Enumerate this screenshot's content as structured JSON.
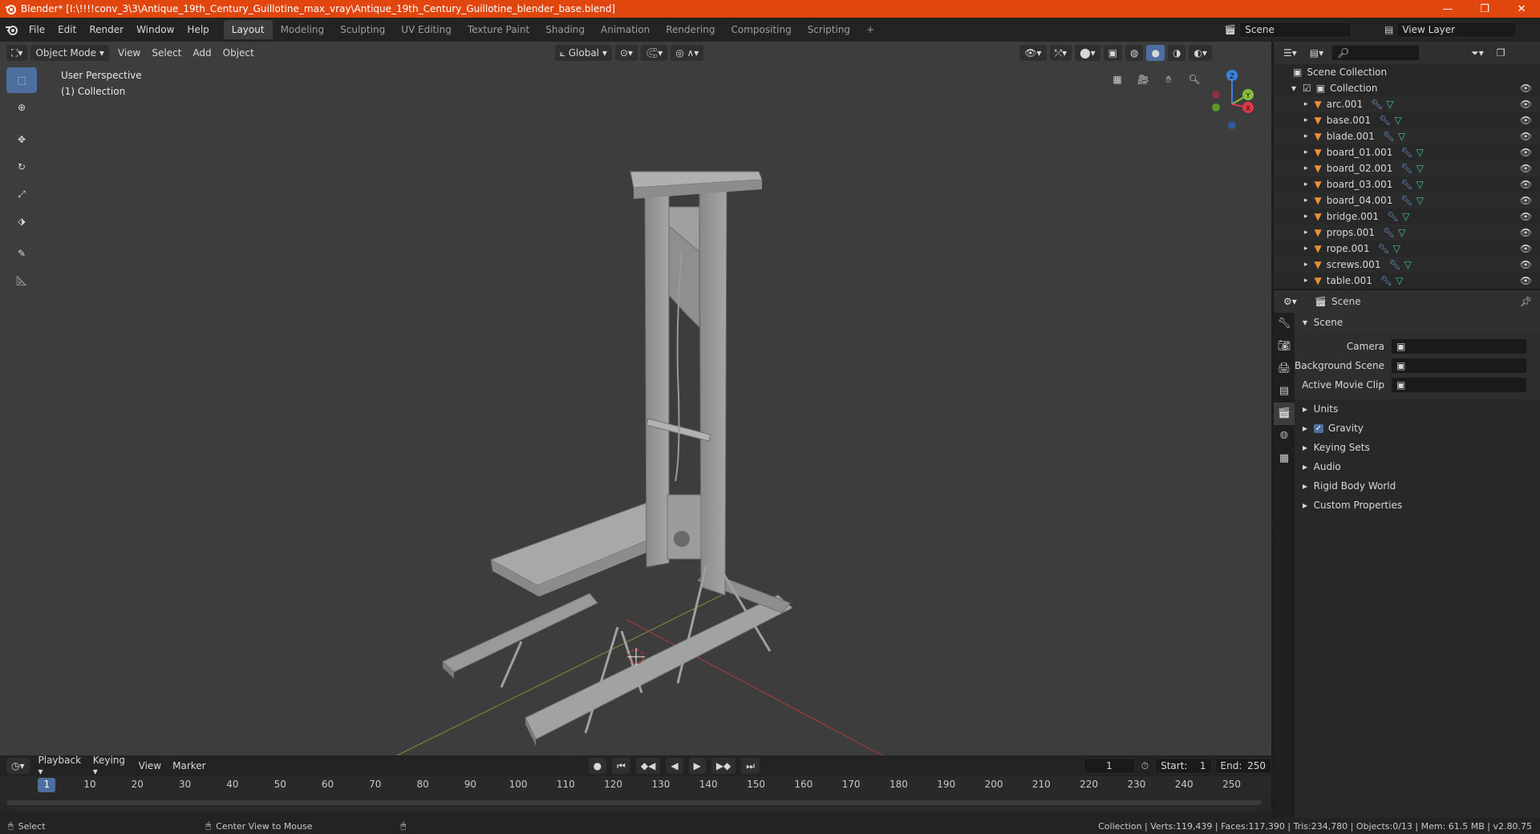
{
  "window": {
    "title": "Blender* [I:\\!!!!conv_3\\3\\Antique_19th_Century_Guillotine_max_vray\\Antique_19th_Century_Guillotine_blender_base.blend]",
    "minimize": "—",
    "maximize": "❐",
    "close": "✕"
  },
  "menu": [
    "File",
    "Edit",
    "Render",
    "Window",
    "Help"
  ],
  "workspaces": [
    "Layout",
    "Modeling",
    "Sculpting",
    "UV Editing",
    "Texture Paint",
    "Shading",
    "Animation",
    "Rendering",
    "Compositing",
    "Scripting"
  ],
  "active_workspace": "Layout",
  "scene_name": "Scene",
  "view_layer": "View Layer",
  "viewport_header": {
    "mode": "Object Mode",
    "menus": [
      "View",
      "Select",
      "Add",
      "Object"
    ],
    "transform_orientation": "Global"
  },
  "viewport": {
    "perspective": "User Perspective",
    "collection": "(1) Collection",
    "gizmo": {
      "z": "Z",
      "y": "Y",
      "x": "X"
    }
  },
  "outliner": {
    "root": "Scene Collection",
    "collection": "Collection",
    "objects": [
      "arc.001",
      "base.001",
      "blade.001",
      "board_01.001",
      "board_02.001",
      "board_03.001",
      "board_04.001",
      "bridge.001",
      "props.001",
      "rope.001",
      "screws.001",
      "table.001"
    ]
  },
  "properties": {
    "context": "Scene",
    "panel_title": "Scene",
    "fields": [
      {
        "label": "Camera",
        "value": ""
      },
      {
        "label": "Background Scene",
        "value": ""
      },
      {
        "label": "Active Movie Clip",
        "value": ""
      }
    ],
    "sections": [
      "Units",
      "Gravity",
      "Keying Sets",
      "Audio",
      "Rigid Body World",
      "Custom Properties"
    ],
    "gravity_checked": true
  },
  "timeline": {
    "menus": [
      "Playback",
      "Keying",
      "View",
      "Marker"
    ],
    "current_frame": "1",
    "start_label": "Start:",
    "start": "1",
    "end_label": "End:",
    "end": "250",
    "ticks": [
      "1",
      "10",
      "20",
      "30",
      "40",
      "50",
      "60",
      "70",
      "80",
      "90",
      "100",
      "110",
      "120",
      "130",
      "140",
      "150",
      "160",
      "170",
      "180",
      "190",
      "200",
      "210",
      "220",
      "230",
      "240",
      "250"
    ]
  },
  "status": {
    "left": "Select",
    "middle": "Center View to Mouse",
    "right": "Collection | Verts:119,439 | Faces:117,390 | Tris:234,780 | Objects:0/13 | Mem: 61.5 MB | v2.80.75"
  },
  "colors": {
    "titlebar": "#e0460e",
    "accent": "#4d6fa0",
    "object_icon": "#e6913a",
    "mesh_icon": "#3fc9a0",
    "x_axis": "#e0384a",
    "y_axis": "#8bbf3a",
    "z_axis": "#3a84e0"
  }
}
